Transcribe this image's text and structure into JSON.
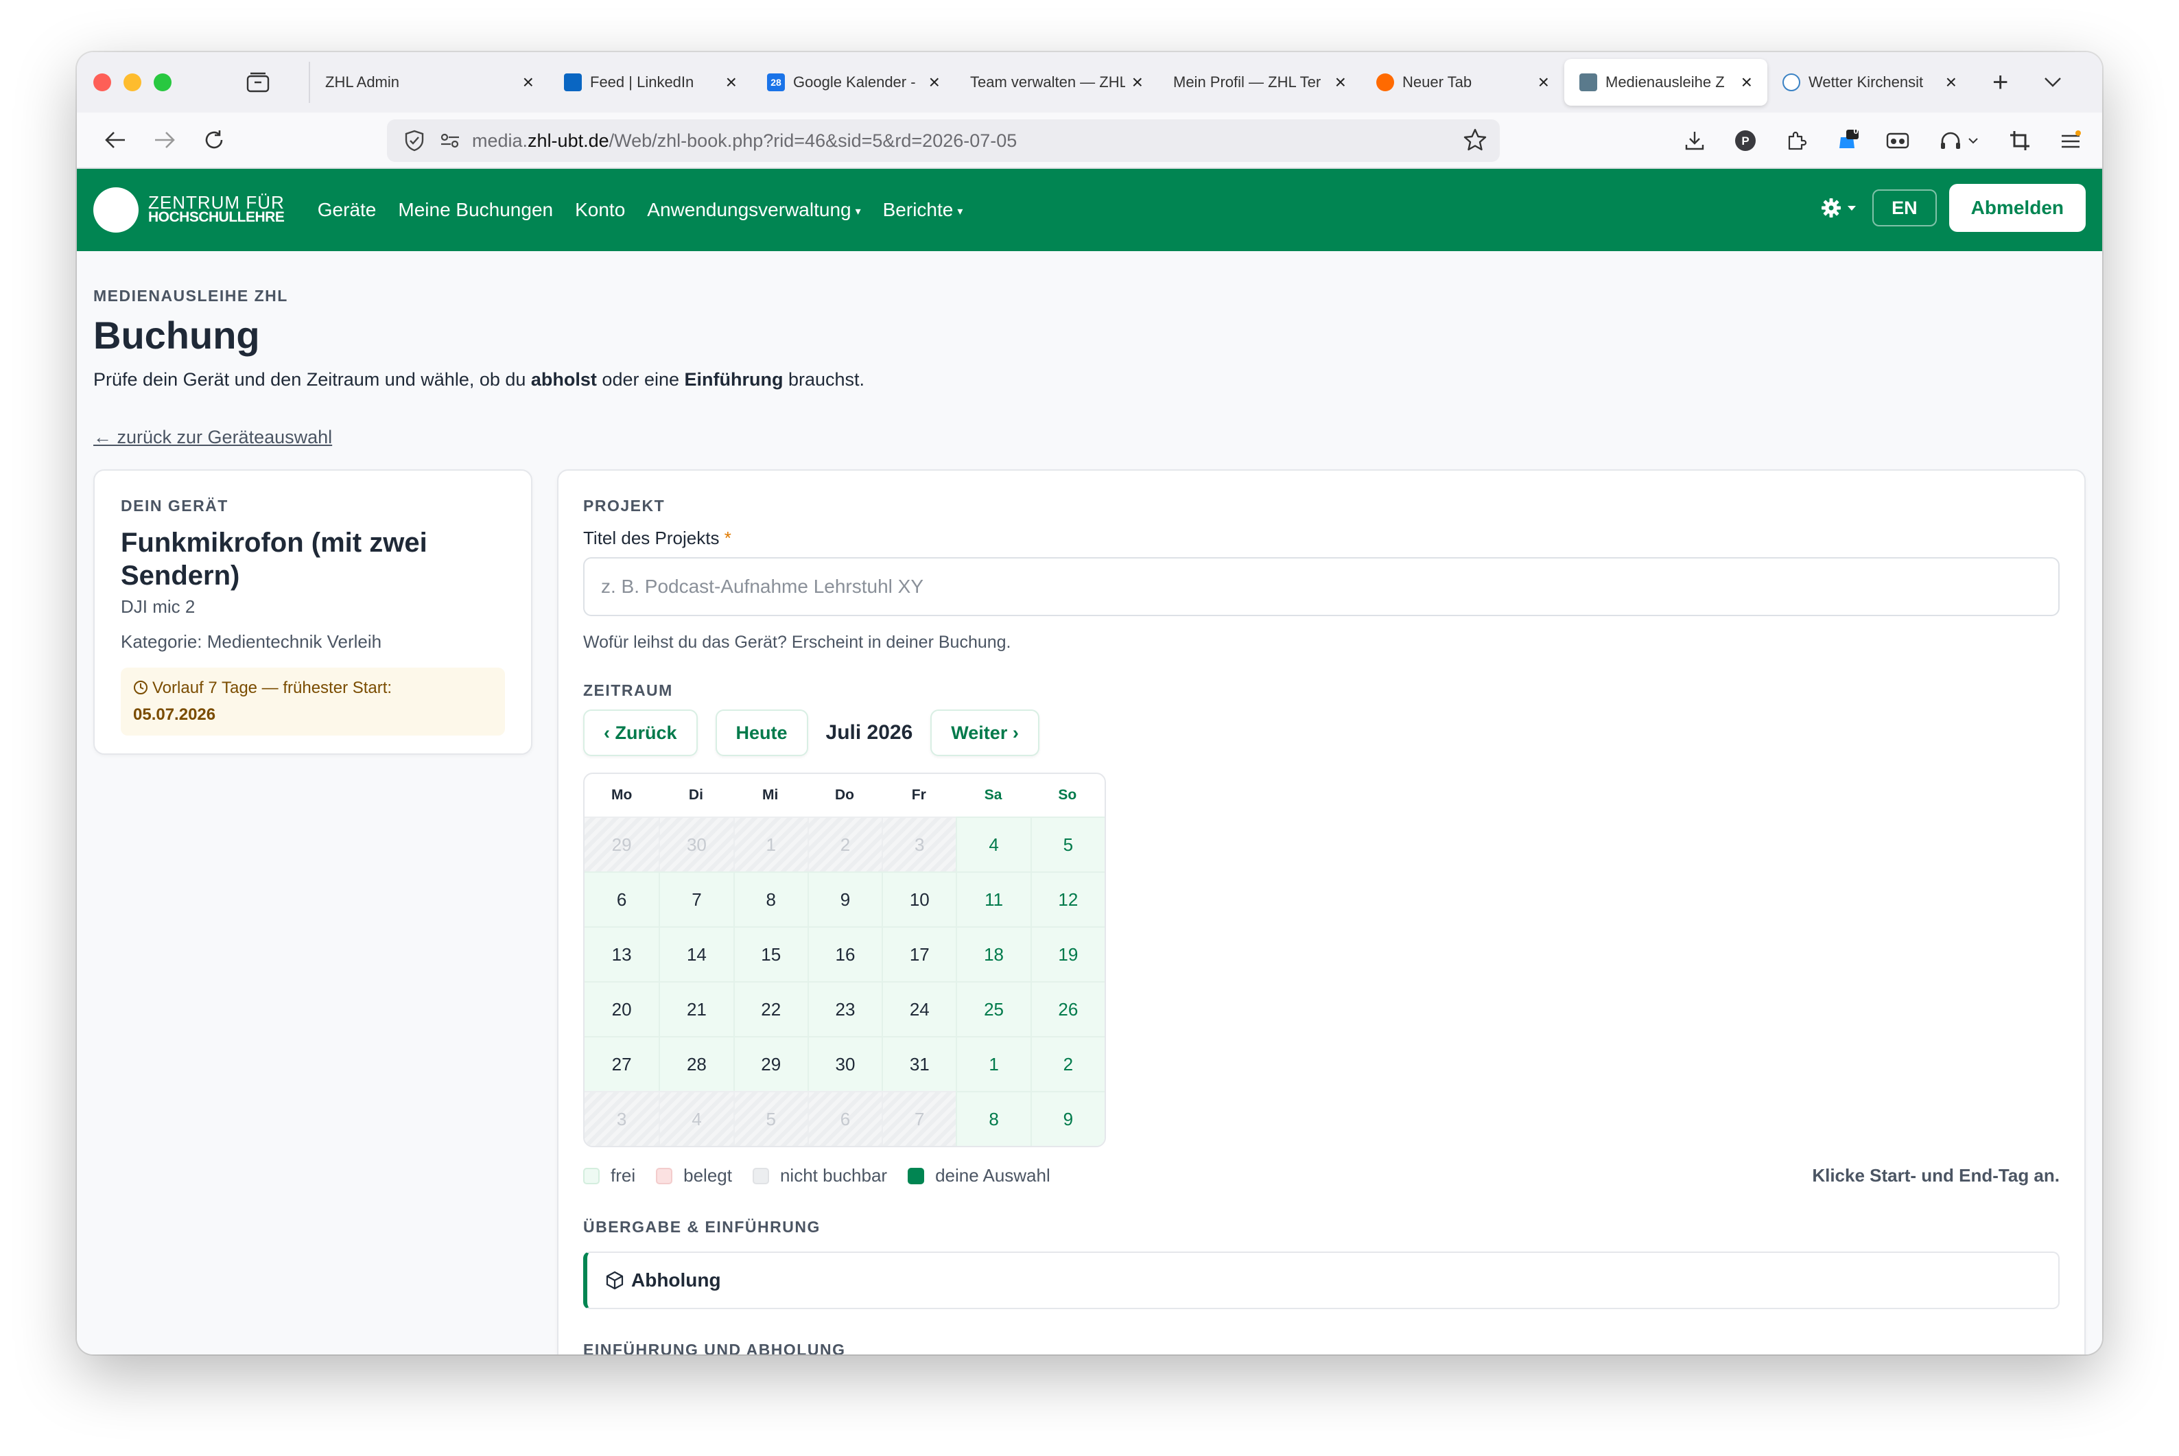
{
  "browser": {
    "tabs": [
      {
        "label": "ZHL Admin",
        "favicon": "none"
      },
      {
        "label": "Feed | LinkedIn",
        "favicon": "linkedin"
      },
      {
        "label": "Google Kalender -",
        "favicon": "calendar-28"
      },
      {
        "label": "Team verwalten — ZHL",
        "favicon": "none"
      },
      {
        "label": "Mein Profil — ZHL Ter",
        "favicon": "none"
      },
      {
        "label": "Neuer Tab",
        "favicon": "firefox"
      },
      {
        "label": "Medienausleihe Z",
        "favicon": "site",
        "active": true
      },
      {
        "label": "Wetter Kirchensit",
        "favicon": "globe"
      }
    ],
    "calendar_favicon_text": "28",
    "url": {
      "prefix": "media.",
      "host": "zhl-ubt.de",
      "path": "/Web/zhl-book.php?rid=46&sid=5&rd=2026-07-05"
    },
    "badge_count": "0",
    "extension_badge": "P"
  },
  "site": {
    "logo_line1": "ZENTRUM FÜR",
    "logo_line2": "HOCHSCHULLEHRE",
    "nav": [
      {
        "label": "Geräte",
        "dropdown": false
      },
      {
        "label": "Meine Buchungen",
        "dropdown": false
      },
      {
        "label": "Konto",
        "dropdown": false
      },
      {
        "label": "Anwendungsverwaltung",
        "dropdown": true
      },
      {
        "label": "Berichte",
        "dropdown": true
      }
    ],
    "lang": "EN",
    "logout": "Abmelden",
    "brand_color": "#018552"
  },
  "page": {
    "eyebrow": "MEDIENAUSLEIHE ZHL",
    "title": "Buchung",
    "subtitle_parts": [
      "Prüfe dein Gerät und den Zeitraum und wähle, ob du ",
      "abholst",
      " oder eine ",
      "Einführung",
      " brauchst."
    ],
    "back_link": "zurück zur Geräteauswahl"
  },
  "device": {
    "eyebrow": "DEIN GERÄT",
    "name": "Funkmikrofon (mit zwei Sendern)",
    "model": "DJI mic 2",
    "category": "Kategorie: Medientechnik Verleih",
    "lead_text": "Vorlauf 7 Tage — frühester Start:",
    "earliest_date": "05.07.2026"
  },
  "project": {
    "eyebrow": "PROJEKT",
    "label": "Titel des Projekts",
    "required_mark": "*",
    "value": "",
    "placeholder": "z. B. Podcast-Aufnahme Lehrstuhl XY",
    "help": "Wofür leihst du das Gerät? Erscheint in deiner Buchung."
  },
  "period": {
    "eyebrow": "ZEITRAUM",
    "prev": "‹ Zurück",
    "today": "Heute",
    "month": "Juli 2026",
    "next": "Weiter ›",
    "weekdays": [
      "Mo",
      "Di",
      "Mi",
      "Do",
      "Fr",
      "Sa",
      "So"
    ],
    "days": [
      {
        "d": "29",
        "s": "off"
      },
      {
        "d": "30",
        "s": "off"
      },
      {
        "d": "1",
        "s": "off"
      },
      {
        "d": "2",
        "s": "off"
      },
      {
        "d": "3",
        "s": "off"
      },
      {
        "d": "4",
        "s": "we"
      },
      {
        "d": "5",
        "s": "we"
      },
      {
        "d": "6",
        "s": "free"
      },
      {
        "d": "7",
        "s": "free"
      },
      {
        "d": "8",
        "s": "free"
      },
      {
        "d": "9",
        "s": "free"
      },
      {
        "d": "10",
        "s": "free"
      },
      {
        "d": "11",
        "s": "we"
      },
      {
        "d": "12",
        "s": "we"
      },
      {
        "d": "13",
        "s": "free"
      },
      {
        "d": "14",
        "s": "free"
      },
      {
        "d": "15",
        "s": "free"
      },
      {
        "d": "16",
        "s": "free"
      },
      {
        "d": "17",
        "s": "free"
      },
      {
        "d": "18",
        "s": "we"
      },
      {
        "d": "19",
        "s": "we"
      },
      {
        "d": "20",
        "s": "free"
      },
      {
        "d": "21",
        "s": "free"
      },
      {
        "d": "22",
        "s": "free"
      },
      {
        "d": "23",
        "s": "free"
      },
      {
        "d": "24",
        "s": "free"
      },
      {
        "d": "25",
        "s": "we"
      },
      {
        "d": "26",
        "s": "we"
      },
      {
        "d": "27",
        "s": "free"
      },
      {
        "d": "28",
        "s": "free"
      },
      {
        "d": "29",
        "s": "free"
      },
      {
        "d": "30",
        "s": "free"
      },
      {
        "d": "31",
        "s": "free"
      },
      {
        "d": "1",
        "s": "we"
      },
      {
        "d": "2",
        "s": "we"
      },
      {
        "d": "3",
        "s": "off"
      },
      {
        "d": "4",
        "s": "off"
      },
      {
        "d": "5",
        "s": "off"
      },
      {
        "d": "6",
        "s": "off"
      },
      {
        "d": "7",
        "s": "off"
      },
      {
        "d": "8",
        "s": "we"
      },
      {
        "d": "9",
        "s": "we"
      }
    ],
    "legend": {
      "free": "frei",
      "busy": "belegt",
      "unavailable": "nicht buchbar",
      "selected": "deine Auswahl"
    },
    "hint": "Klicke Start- und End-Tag an."
  },
  "handover": {
    "eyebrow": "ÜBERGABE & EINFÜHRUNG",
    "option": "Abholung",
    "next_eyebrow": "EINFÜHRUNG UND ABHOLUNG"
  }
}
